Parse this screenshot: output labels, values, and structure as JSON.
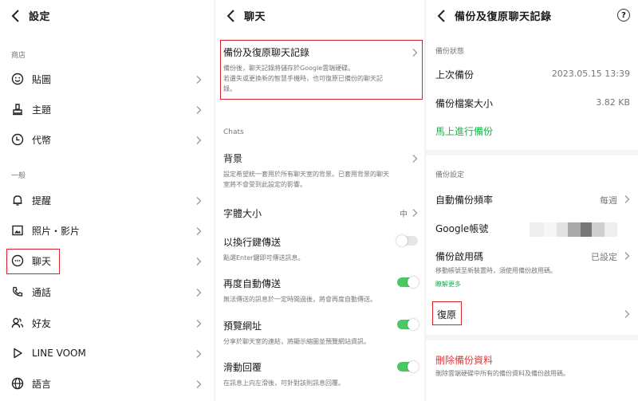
{
  "screen1": {
    "title": "設定",
    "section_shop": "商店",
    "shop_items": [
      {
        "label": "貼圖",
        "icon": "smiley-icon"
      },
      {
        "label": "主題",
        "icon": "brush-icon"
      },
      {
        "label": "代幣",
        "icon": "coin-icon"
      }
    ],
    "section_general": "一般",
    "general_items": [
      {
        "label": "提醒",
        "icon": "bell-icon"
      },
      {
        "label": "照片・影片",
        "icon": "photo-icon"
      },
      {
        "label": "聊天",
        "icon": "chat-icon"
      },
      {
        "label": "通話",
        "icon": "phone-icon"
      },
      {
        "label": "好友",
        "icon": "friends-icon"
      },
      {
        "label": "LINE VOOM",
        "icon": "play-icon"
      },
      {
        "label": "語言",
        "icon": "globe-icon"
      }
    ]
  },
  "screen2": {
    "title": "聊天",
    "backup": {
      "title": "備份及復原聊天記錄",
      "desc1": "備份後，聊天記錄將儲存於Google雲端硬碟。",
      "desc2": "若遺失或更換新的智慧手機時，也可復原已備份的聊天記",
      "desc3": "錄。"
    },
    "section_chats": "Chats",
    "background": {
      "title": "背景",
      "desc1": "設定希望統一套用於所有聊天室的背景。已套用背景的聊天",
      "desc2": "室將不會受到此設定的影響。"
    },
    "font_size": {
      "title": "字體大小",
      "value": "中"
    },
    "enter_send": {
      "title": "以換行鍵傳送",
      "desc": "點選Enter鍵即可傳送訊息。",
      "on": false
    },
    "auto_resend": {
      "title": "再度自動傳送",
      "desc": "無法傳送的訊息於一定時間過後，將會再度自動傳送。",
      "on": true
    },
    "url_preview": {
      "title": "預覽網址",
      "desc": "分享於聊天室的連結，將顯示縮圖並預覽網站資訊。",
      "on": true
    },
    "swipe_reply": {
      "title": "滑動回覆",
      "desc": "在訊息上向左滑後，可針對該則訊息回覆。",
      "on": true
    }
  },
  "screen3": {
    "title": "備份及復原聊天記錄",
    "help": "?",
    "section_status": "備份狀態",
    "last_backup_label": "上次備份",
    "last_backup_value": "2023.05.15 13:39",
    "size_label": "備份檔案大小",
    "size_value": "3.82 KB",
    "backup_now": "馬上進行備份",
    "section_settings": "備份設定",
    "freq_label": "自動備份頻率",
    "freq_value": "每週",
    "google_label": "Google帳號",
    "pin_label": "備份啟用碼",
    "pin_value": "已設定",
    "pin_desc": "移動帳號至新裝置時，須使用備份啟用碼。",
    "learn_more": "瞭解更多",
    "restore": "復原",
    "delete_title": "刪除備份資料",
    "delete_desc": "刪除雲端硬碟中所有的備份資料及備份啟用碼。"
  },
  "colors": {
    "accent_green": "#19b34a",
    "toggle_green": "#4cc765",
    "highlight_red": "#d9202a",
    "delete_red": "#e23a3a"
  }
}
